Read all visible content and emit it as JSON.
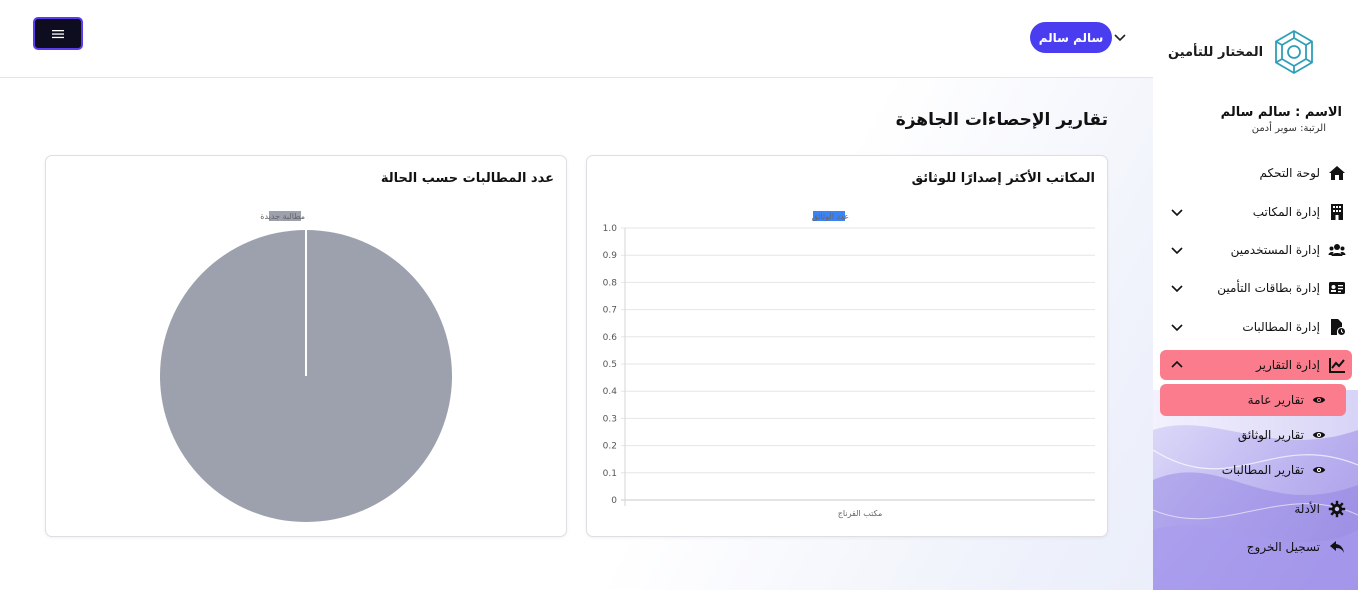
{
  "sidebar": {
    "logo_text": "المختار للتأمين",
    "user_name": "الاسم : سالم سالم",
    "role_label": "الرتبة:",
    "role_value": "سوبر أدمن",
    "items": [
      {
        "label": "لوحة التحكم",
        "icon": "home-icon"
      },
      {
        "label": "إدارة المكاتب",
        "icon": "building-icon"
      },
      {
        "label": "إدارة المستخدمين",
        "icon": "users-icon"
      },
      {
        "label": "إدارة بطاقات التأمين",
        "icon": "id-card-icon"
      },
      {
        "label": "إدارة المطالبات",
        "icon": "file-clock-icon"
      },
      {
        "label": "إدارة التقارير",
        "icon": "chart-line-icon"
      }
    ],
    "reports_sub": [
      {
        "label": "تقارير عامة",
        "icon": "eye-icon"
      },
      {
        "label": "تقارير الوثائق",
        "icon": "eye-icon"
      },
      {
        "label": "تقارير المطالبات",
        "icon": "eye-icon"
      }
    ],
    "settings_label": "الأدلة",
    "logout_label": "تسجيل الخروج"
  },
  "topbar": {
    "user_label": "سالم سالم"
  },
  "main": {
    "page_title": "تقارير الإحصاءات الجاهزة",
    "cards": {
      "claims_title": "عدد المطالبات حسب الحالة",
      "offices_title": "المكاتب الأكثر إصدارًا للوثائق"
    }
  },
  "chart_data": [
    {
      "type": "bar",
      "title": "المكاتب الأكثر إصدارًا للوثائق",
      "categories": [
        "مكتب القرناج"
      ],
      "series": [
        {
          "name": "عدد الوثائق",
          "values": [
            0
          ],
          "color": "#3b82f6"
        }
      ],
      "ylim": [
        0,
        1.0
      ],
      "yticks": [
        "1.0",
        "0.9",
        "0.8",
        "0.7",
        "0.6",
        "0.5",
        "0.4",
        "0.3",
        "0.2",
        "0.1",
        "0"
      ],
      "grid": true,
      "legend": "top"
    },
    {
      "type": "pie",
      "title": "عدد المطالبات حسب الحالة",
      "labels": [
        "مطالبة جديدة"
      ],
      "values": [
        1
      ],
      "colors": [
        "#9ca1ad"
      ],
      "legend": "top"
    }
  ]
}
